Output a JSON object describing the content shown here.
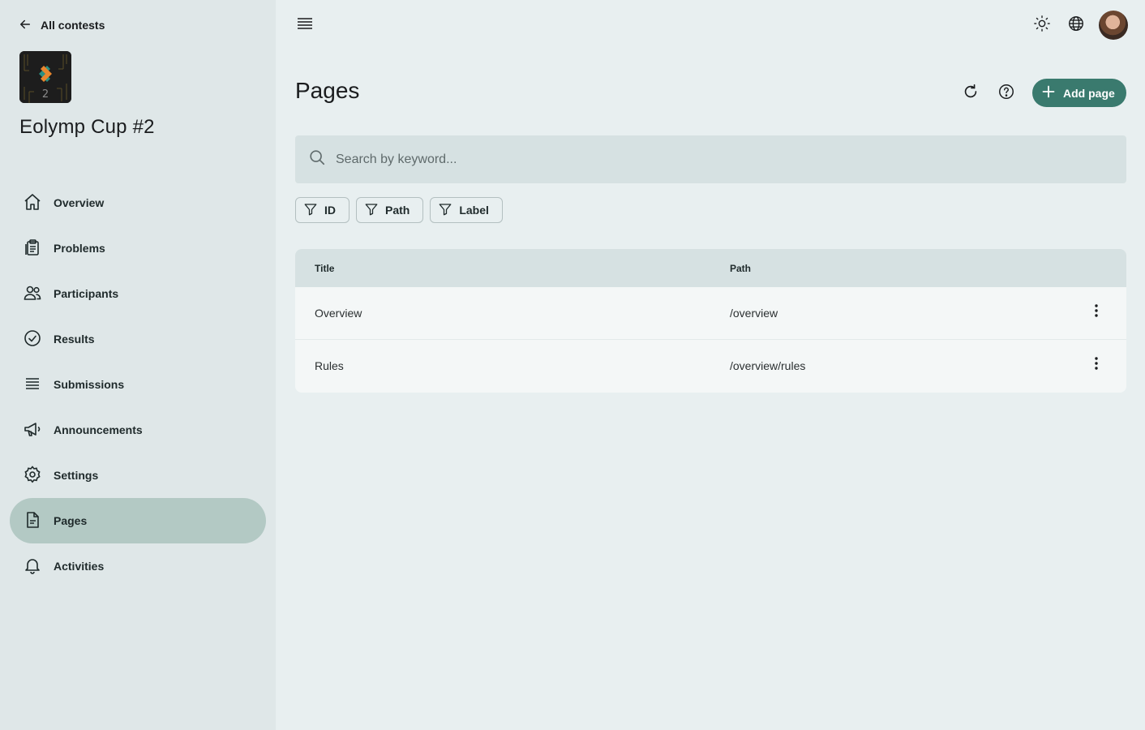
{
  "sidebar": {
    "back_label": "All contests",
    "logo_text": "2",
    "contest_title": "Eolymp Cup #2",
    "items": [
      {
        "label": "Overview",
        "icon": "home-icon"
      },
      {
        "label": "Problems",
        "icon": "clipboard-icon"
      },
      {
        "label": "Participants",
        "icon": "people-icon"
      },
      {
        "label": "Results",
        "icon": "check-circle-icon"
      },
      {
        "label": "Submissions",
        "icon": "list-icon"
      },
      {
        "label": "Announcements",
        "icon": "megaphone-icon"
      },
      {
        "label": "Settings",
        "icon": "gear-icon"
      },
      {
        "label": "Pages",
        "icon": "document-icon",
        "active": true
      },
      {
        "label": "Activities",
        "icon": "bell-icon"
      }
    ]
  },
  "topbar": {
    "icons": [
      "menu-icon",
      "sun-icon",
      "globe-icon",
      "avatar"
    ]
  },
  "header": {
    "title": "Pages",
    "add_label": "Add page"
  },
  "search": {
    "placeholder": "Search by keyword...",
    "value": ""
  },
  "filters": [
    "ID",
    "Path",
    "Label"
  ],
  "table": {
    "columns": [
      "Title",
      "Path"
    ],
    "rows": [
      {
        "title": "Overview",
        "path": "/overview"
      },
      {
        "title": "Rules",
        "path": "/overview/rules"
      }
    ]
  },
  "colors": {
    "background": "#e8eff0",
    "sidebar": "#dfe7e8",
    "active_nav": "#b3c9c4",
    "accent": "#3a7a6e"
  }
}
